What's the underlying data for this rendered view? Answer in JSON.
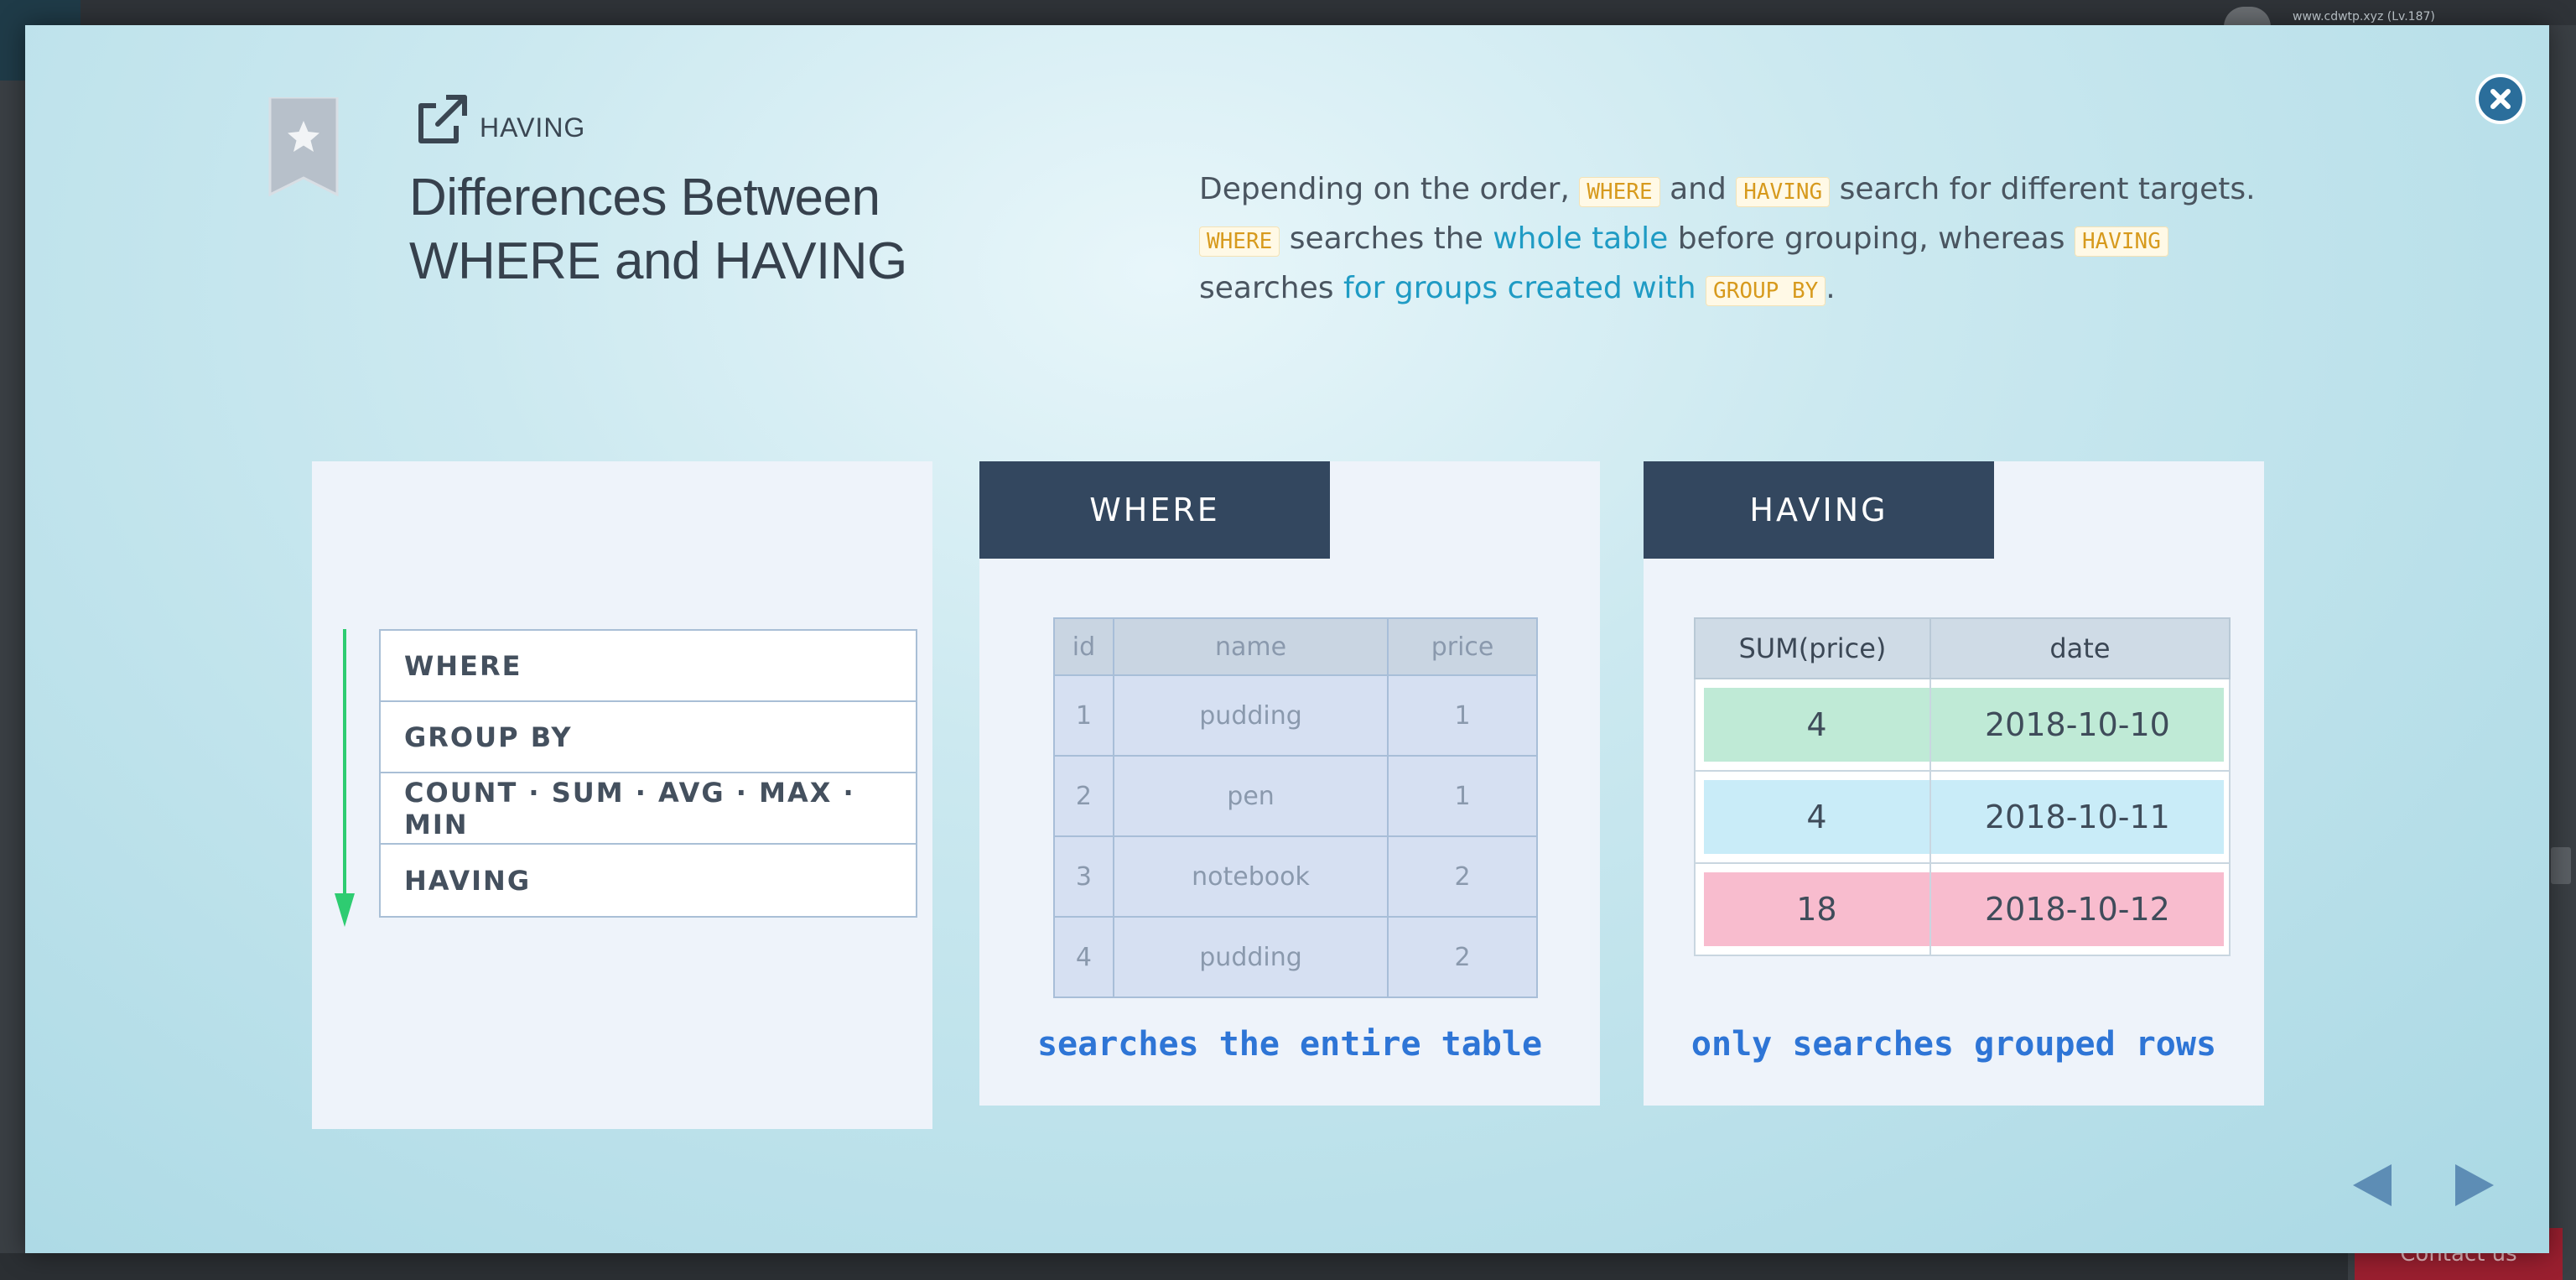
{
  "background": {
    "address_text": "www.cdwtp.xyz (Lv.187)",
    "contact_label": "Contact us"
  },
  "header": {
    "kicker": "HAVING",
    "title_line1": "Differences Between",
    "title_line2": "WHERE and HAVING"
  },
  "description": {
    "part1": "Depending on the order, ",
    "code_where": "WHERE",
    "part2": " and ",
    "code_having": "HAVING",
    "part3": " search for different targets. ",
    "code_where2": "WHERE",
    "part4": " searches the ",
    "highlight1": "whole table",
    "part5": " before grouping, whereas ",
    "code_having2": "HAVING",
    "part6": " searches ",
    "highlight2": "for groups created with",
    "part7": " ",
    "code_groupby": "GROUP BY",
    "part8": "."
  },
  "order_panel": {
    "items": [
      "WHERE",
      "GROUP BY",
      "COUNT · SUM · AVG · MAX · MIN",
      "HAVING"
    ]
  },
  "where_panel": {
    "tab_label": "WHERE",
    "columns": [
      "id",
      "name",
      "price"
    ],
    "rows": [
      [
        "1",
        "pudding",
        "1"
      ],
      [
        "2",
        "pen",
        "1"
      ],
      [
        "3",
        "notebook",
        "2"
      ],
      [
        "4",
        "pudding",
        "2"
      ]
    ],
    "caption": "searches the entire table"
  },
  "having_panel": {
    "tab_label": "HAVING",
    "columns": [
      "SUM(price)",
      "date"
    ],
    "rows": [
      [
        "4",
        "2018-10-10"
      ],
      [
        "4",
        "2018-10-11"
      ],
      [
        "18",
        "2018-10-12"
      ]
    ],
    "caption": "only searches grouped rows"
  },
  "colors": {
    "accent_dark": "#33475f",
    "code_text": "#d79a1d",
    "highlight": "#1f9bc4",
    "caption_blue": "#2e75d6",
    "arrow_green": "#2ecc71",
    "row_green": "#bfead6",
    "row_blue": "#c9ecf8",
    "row_pink": "#f8bcce"
  },
  "icons": {
    "close": "close-icon",
    "bookmark": "bookmark-star-icon",
    "share": "external-link-icon",
    "prev": "triangle-left-icon",
    "next": "triangle-right-icon"
  }
}
